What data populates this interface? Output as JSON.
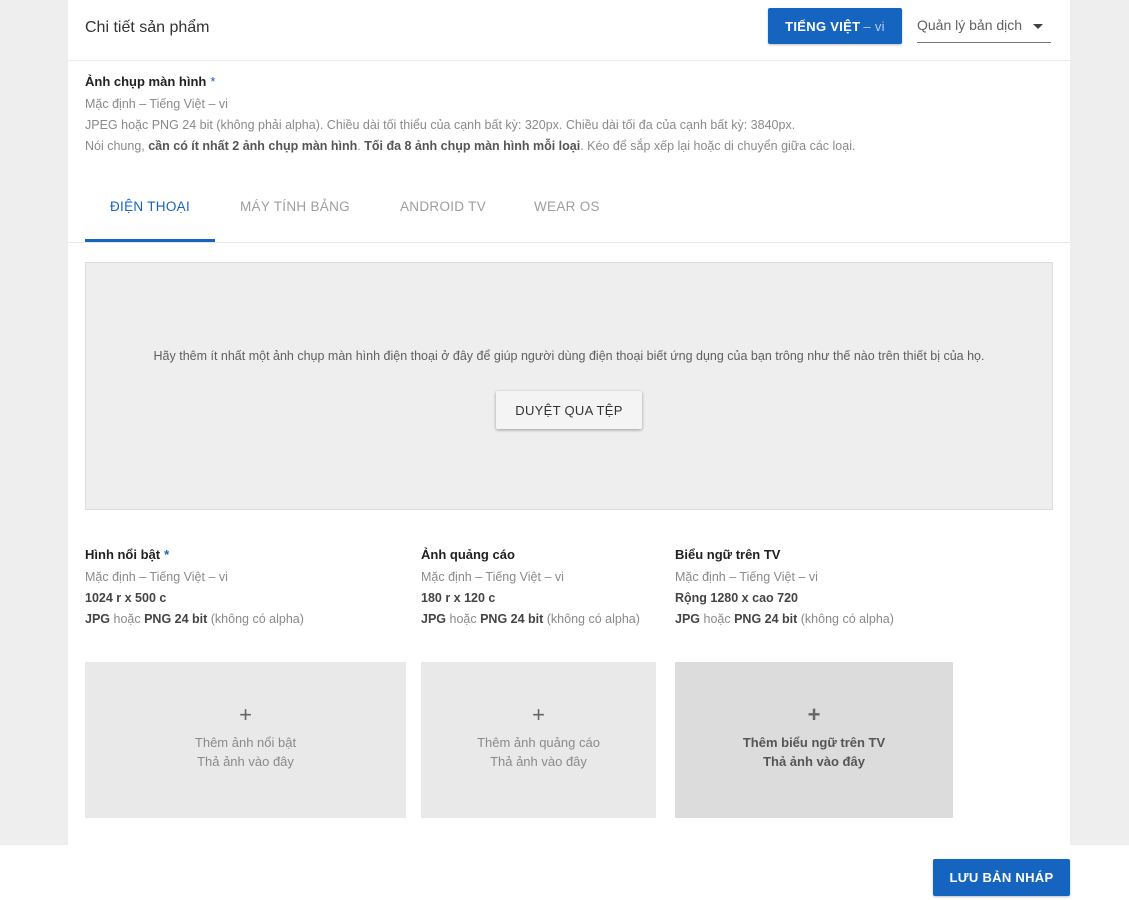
{
  "header": {
    "title": "Chi tiết sản phẩm",
    "language_button": {
      "label": "TIẾNG VIỆT",
      "suffix": "– vi"
    },
    "manage_translations": "Quản lý bản dịch"
  },
  "screenshots": {
    "label": "Ảnh chụp màn hình",
    "required_mark": "*",
    "default_lang": "Mặc định – Tiếng Việt – vi",
    "spec": "JPEG hoặc PNG 24 bit (không phải alpha). Chiều dài tối thiểu của cạnh bất kỳ: 320px. Chiều dài tối đa của cạnh bất kỳ: 3840px.",
    "note_prefix": "Nói chung, ",
    "note_bold1": "cần có ít nhất 2 ảnh chụp màn hình",
    "note_mid": ". ",
    "note_bold2": "Tối đa 8 ảnh chụp màn hình mỗi loại",
    "note_suffix": ". Kéo để sắp xếp lại hoặc di chuyển giữa các loại."
  },
  "tabs": [
    {
      "label": "ĐIỆN THOẠI",
      "active": true
    },
    {
      "label": "MÁY TÍNH BẢNG",
      "active": false
    },
    {
      "label": "ANDROID TV",
      "active": false
    },
    {
      "label": "WEAR OS",
      "active": false
    }
  ],
  "dropzone": {
    "message": "Hãy thêm ít nhất một ảnh chụp màn hình điện thoại ở đây để giúp người dùng điện thoại biết ứng dụng của bạn trông như thế nào trên thiết bị của họ.",
    "browse_label": "DUYỆT QUA TỆP"
  },
  "assets": [
    {
      "title": "Hình nổi bật",
      "required_mark": "*",
      "default_lang": "Mặc định – Tiếng Việt – vi",
      "size": "1024 r x 500 c",
      "format_bold1": "JPG",
      "format_mid": " hoặc ",
      "format_bold2": "PNG 24 bit",
      "format_suffix": " (không có alpha)",
      "tile_line1": "Thêm ảnh nổi bật",
      "tile_line2": "Thả ảnh vào đây"
    },
    {
      "title": "Ảnh quảng cáo",
      "required_mark": "",
      "default_lang": "Mặc định – Tiếng Việt – vi",
      "size": "180 r x 120 c",
      "format_bold1": "JPG",
      "format_mid": " hoặc ",
      "format_bold2": "PNG 24 bit",
      "format_suffix": " (không có alpha)",
      "tile_line1": "Thêm ảnh quảng cáo",
      "tile_line2": "Thả ảnh vào đây"
    },
    {
      "title": "Biểu ngữ trên TV",
      "required_mark": "",
      "default_lang": "Mặc định – Tiếng Việt – vi",
      "size": "Rộng 1280 x cao 720",
      "format_bold1": "JPG",
      "format_mid": " hoặc ",
      "format_bold2": "PNG 24 bit",
      "format_suffix": " (không có alpha)",
      "tile_line1": "Thêm biểu ngữ trên TV",
      "tile_line2": "Thả ảnh vào đây"
    }
  ],
  "footer": {
    "save_draft": "LƯU BẢN NHÁP"
  },
  "colors": {
    "accent": "#1565c0",
    "page_bg": "#eeeeee",
    "tile_bg": "#e9e9e9"
  },
  "icons": {
    "caret": "caret-down-icon",
    "add": "plus-icon"
  }
}
